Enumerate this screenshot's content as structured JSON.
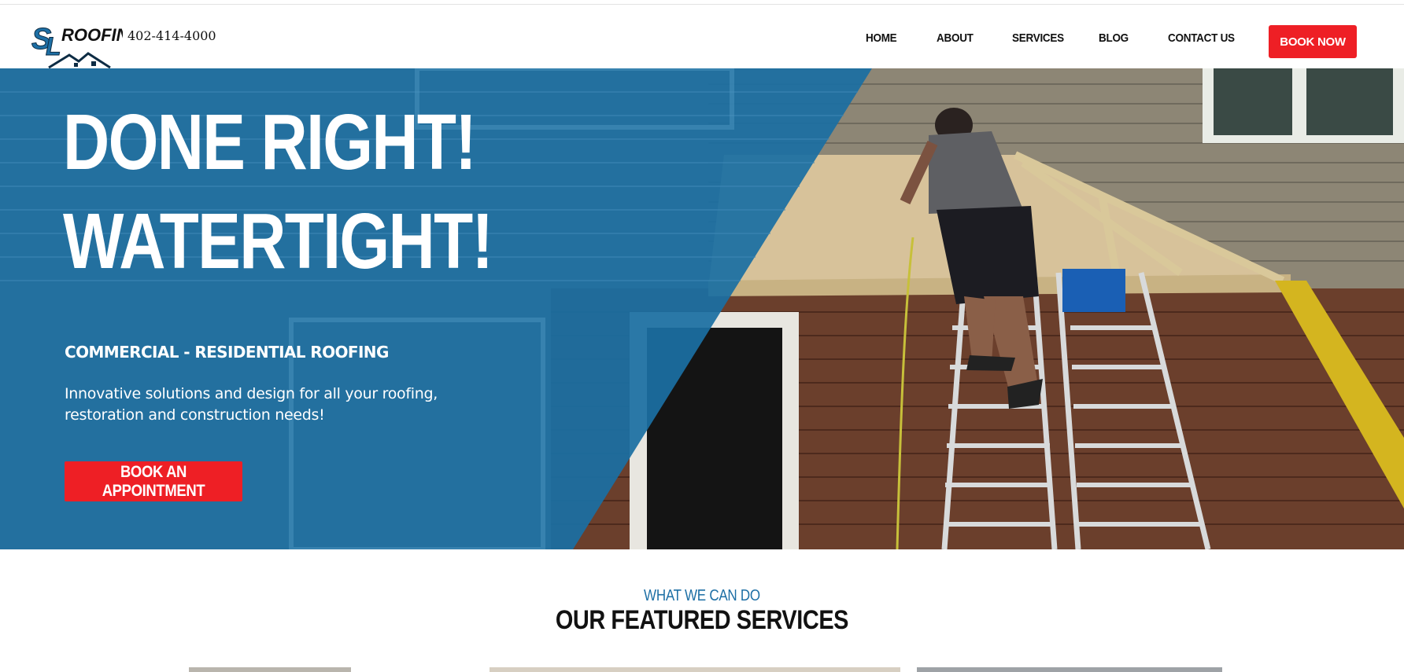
{
  "header": {
    "logo_text": "SL ROOFING",
    "phone": "402-414-4000",
    "nav": [
      "HOME",
      "ABOUT",
      "SERVICES",
      "BLOG",
      "CONTACT US"
    ],
    "cta": "BOOK NOW"
  },
  "hero": {
    "headline_line1": "DONE RIGHT!",
    "headline_line2": "WATERTIGHT!",
    "subheading": "COMMERCIAL - RESIDENTIAL ROOFING",
    "description": "Innovative solutions and design for all your roofing, restoration and construction needs!",
    "button": "BOOK AN APPOINTMENT"
  },
  "services": {
    "kicker": "WHAT WE CAN DO",
    "title": "OUR FEATURED SERVICES"
  },
  "colors": {
    "accent_red": "#ee1f25",
    "overlay_blue": "#1b6fa3",
    "kicker_blue": "#1d6fa5"
  }
}
